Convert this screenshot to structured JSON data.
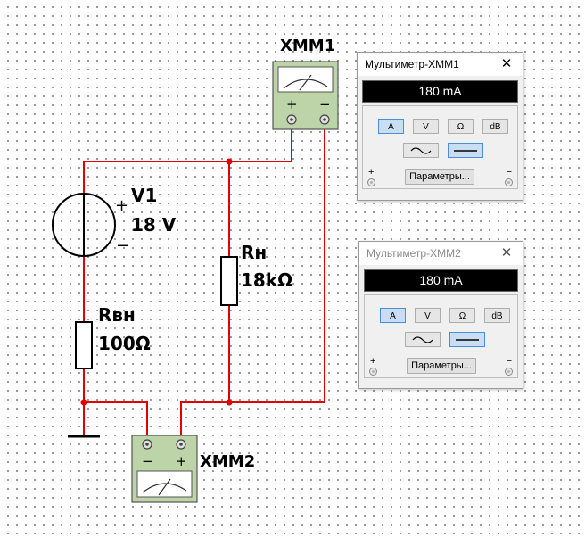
{
  "schematic": {
    "xmm1_label": "XMM1",
    "xmm2_label": "XMM2",
    "source": {
      "name": "V1",
      "value": "18 V",
      "plus": "+",
      "minus": "−"
    },
    "r_internal": {
      "name": "Rвн",
      "value": "100Ω"
    },
    "r_load": {
      "name": "Rн",
      "value": "18kΩ"
    },
    "xmm1_pins": {
      "plus": "+",
      "minus": "−"
    },
    "xmm2_pins": {
      "plus": "+",
      "minus": "−"
    },
    "wire_color": "#e00000"
  },
  "multimeters": [
    {
      "title": "Мультиметр-XMM1",
      "reading": "180 mA",
      "buttons": {
        "amp": "A",
        "volt": "V",
        "ohm": "Ω",
        "db": "dB"
      },
      "active_mode": "A",
      "active_wave": "dc",
      "params_label": "Параметры...",
      "plus": "+",
      "minus": "−",
      "close": "✕"
    },
    {
      "title": "Мультиметр-XMM2",
      "reading": "180 mA",
      "buttons": {
        "amp": "A",
        "volt": "V",
        "ohm": "Ω",
        "db": "dB"
      },
      "active_mode": "A",
      "active_wave": "dc",
      "params_label": "Параметры...",
      "plus": "+",
      "minus": "−",
      "close": "✕"
    }
  ]
}
